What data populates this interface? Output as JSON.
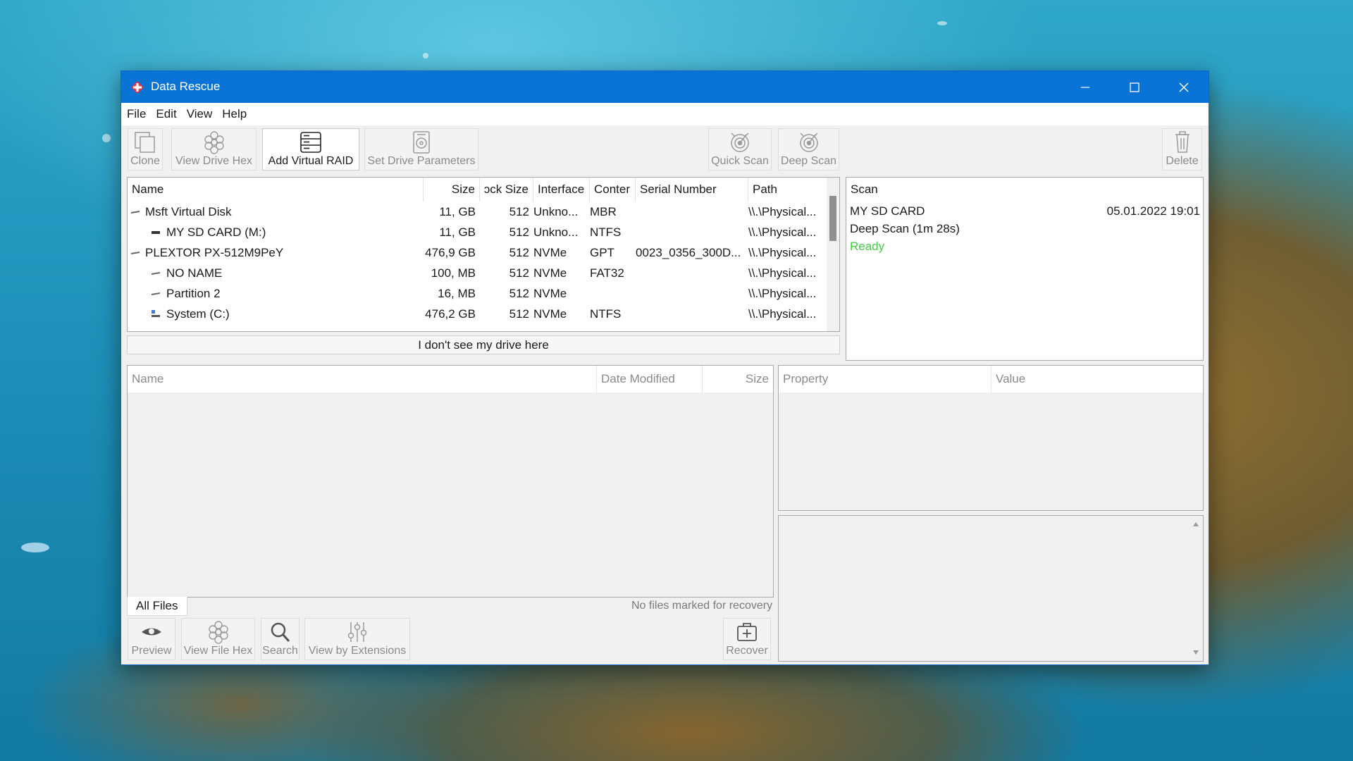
{
  "window": {
    "title": "Data Rescue"
  },
  "menu": [
    "File",
    "Edit",
    "View",
    "Help"
  ],
  "toolbar": {
    "clone": "Clone",
    "view_drive_hex": "View Drive Hex",
    "add_virtual_raid": "Add Virtual RAID",
    "set_drive_parameters": "Set Drive Parameters",
    "quick_scan": "Quick Scan",
    "deep_scan": "Deep Scan",
    "delete": "Delete"
  },
  "drives": {
    "columns": [
      "Name",
      "Size",
      "ɔck Size",
      "Interface",
      "Conter",
      "Serial Number",
      "Path"
    ],
    "rows": [
      {
        "name": "Msft Virtual Disk",
        "size": "11, GB",
        "block": "512",
        "interface": "Unkno...",
        "content": "MBR",
        "serial": "",
        "path": "\\\\.\\Physical...",
        "level": 0,
        "icon": "disk-icon"
      },
      {
        "name": "MY SD CARD (M:)",
        "size": "11, GB",
        "block": "512",
        "interface": "Unkno...",
        "content": "NTFS",
        "serial": "",
        "path": "\\\\.\\Physical...",
        "level": 1,
        "icon": "volume-icon"
      },
      {
        "name": "PLEXTOR PX-512M9PeY",
        "size": "476,9 GB",
        "block": "512",
        "interface": "NVMe",
        "content": "GPT",
        "serial": "0023_0356_300D...",
        "path": "\\\\.\\Physical...",
        "level": 0,
        "icon": "disk-icon"
      },
      {
        "name": "NO NAME",
        "size": "100, MB",
        "block": "512",
        "interface": "NVMe",
        "content": "FAT32",
        "serial": "",
        "path": "\\\\.\\Physical...",
        "level": 1,
        "icon": "partition-icon"
      },
      {
        "name": "Partition 2",
        "size": "16, MB",
        "block": "512",
        "interface": "NVMe",
        "content": "",
        "serial": "",
        "path": "\\\\.\\Physical...",
        "level": 1,
        "icon": "partition-icon"
      },
      {
        "name": "System (C:)",
        "size": "476,2 GB",
        "block": "512",
        "interface": "NVMe",
        "content": "NTFS",
        "serial": "",
        "path": "\\\\.\\Physical...",
        "level": 1,
        "icon": "windows-drive-icon"
      }
    ],
    "dont_see_label": "I don't see my drive here"
  },
  "scan_panel": {
    "header": "Scan",
    "name": "MY SD CARD",
    "date": "05.01.2022 19:01",
    "type": "Deep Scan (1m 28s)",
    "status": "Ready",
    "status_color": "#3fcf3f"
  },
  "files": {
    "columns": [
      "Name",
      "Date Modified",
      "Size"
    ],
    "tab": "All Files",
    "status": "No files marked for recovery"
  },
  "properties": {
    "columns": [
      "Property",
      "Value"
    ]
  },
  "bottom_toolbar": {
    "preview": "Preview",
    "view_file_hex": "View File Hex",
    "search": "Search",
    "view_by_extensions": "View by Extensions",
    "recover": "Recover"
  }
}
